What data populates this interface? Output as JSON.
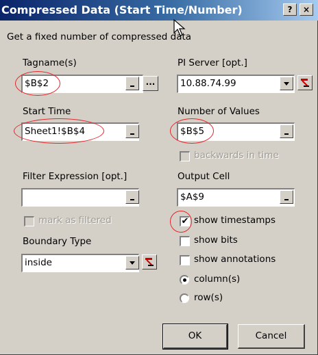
{
  "window": {
    "title": "Compressed Data (Start Time/Number)",
    "help_label": "?",
    "close_label": "×"
  },
  "description": "Get a fixed number of compressed data",
  "tagnames": {
    "label": "Tagname(s)",
    "value": "$B$2",
    "ellipsis": "..."
  },
  "pi_server": {
    "label": "PI Server [opt.]",
    "value": "10.88.74.99"
  },
  "start_time": {
    "label": "Start Time",
    "value": "Sheet1!$B$4"
  },
  "number_of_values": {
    "label": "Number of Values",
    "value": "$B$5"
  },
  "backwards_in_time": {
    "label": "backwards in time",
    "checked": false,
    "enabled": false
  },
  "filter_expression": {
    "label": "Filter Expression [opt.]",
    "value": ""
  },
  "output_cell": {
    "label": "Output Cell",
    "value": "$A$9"
  },
  "mark_as_filtered": {
    "label": "mark as filtered",
    "checked": false,
    "enabled": false
  },
  "show_timestamps": {
    "label": "show timestamps",
    "checked": true,
    "check_glyph": "✔"
  },
  "boundary_type": {
    "label": "Boundary Type",
    "value": "inside"
  },
  "show_bits": {
    "label": "show bits",
    "checked": false
  },
  "show_annotations": {
    "label": "show annotations",
    "checked": false
  },
  "orientation": {
    "options": [
      {
        "label": "column(s)",
        "selected": true
      },
      {
        "label": "row(s)",
        "selected": false
      }
    ]
  },
  "buttons": {
    "ok": "OK",
    "cancel": "Cancel"
  },
  "colors": {
    "highlight_circle": "#e8232a",
    "title_bar": "#0a246a",
    "face": "#d4d0c8"
  }
}
